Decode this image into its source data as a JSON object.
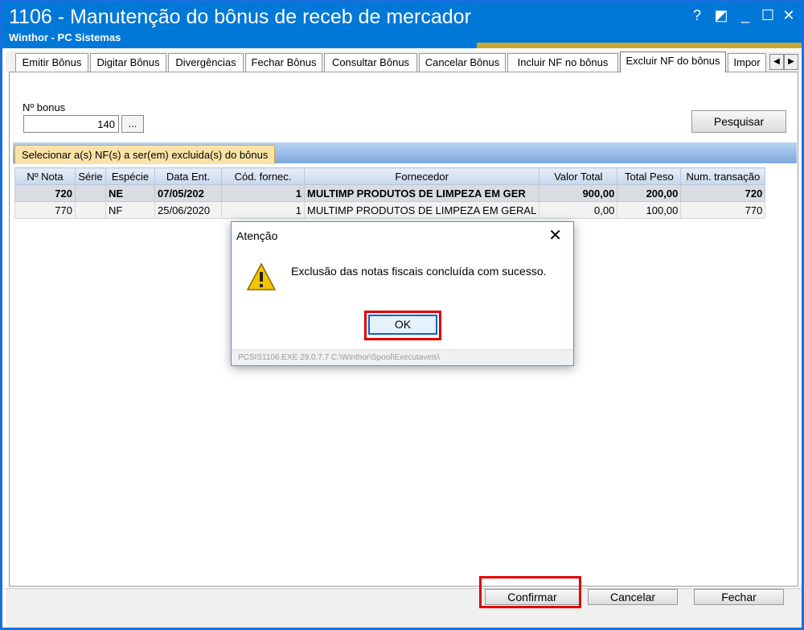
{
  "window": {
    "title": "1106 - Manutenção do bônus de receb de mercador",
    "subtitle": "Winthor - PC Sistemas",
    "help_glyph": "?",
    "restore_glyph": "◩",
    "minimize_glyph": "_",
    "maximize_glyph": "☐",
    "close_glyph": "✕"
  },
  "tabs": [
    {
      "label": "Emitir Bônus"
    },
    {
      "label": "Digitar Bônus"
    },
    {
      "label": "Divergências"
    },
    {
      "label": "Fechar Bônus"
    },
    {
      "label": "Consultar Bônus"
    },
    {
      "label": "Cancelar Bônus"
    },
    {
      "label": "Incluir NF no bônus"
    },
    {
      "label": "Excluir NF do bônus"
    },
    {
      "label": "Impor"
    }
  ],
  "tab_scroll": {
    "left": "◀",
    "right": "▶"
  },
  "form": {
    "bonus_label": "Nº bonus",
    "bonus_value": "140",
    "dots_label": "...",
    "search_button": "Pesquisar"
  },
  "subtab": {
    "label": "Selecionar a(s) NF(s) a ser(em) excluida(s) do bônus"
  },
  "grid": {
    "headers": [
      "Nº Nota",
      "Série",
      "Espécie",
      "Data Ent.",
      "Cód. fornec.",
      "Fornecedor",
      "Valor Total",
      "Total Peso",
      "Num. transação"
    ],
    "rows": [
      [
        "720",
        "",
        "NE",
        "07/05/202",
        "1",
        "MULTIMP PRODUTOS DE LIMPEZA EM GER",
        "900,00",
        "200,00",
        "720"
      ],
      [
        "770",
        "",
        "NF",
        "25/06/2020",
        "1",
        "MULTIMP PRODUTOS DE LIMPEZA EM GERAL",
        "0,00",
        "100,00",
        "770"
      ]
    ]
  },
  "bottom_buttons": {
    "confirm": "Confirmar",
    "cancel": "Cancelar",
    "close": "Fechar"
  },
  "dialog": {
    "title": "Atenção",
    "close_glyph": "✕",
    "message": "Exclusão das notas fiscais concluída com sucesso.",
    "ok_label": "OK",
    "footer": "PCSIS1106.EXE 29.0.7.7 C:\\Winthor\\Spool\\Executaveis\\"
  },
  "colors": {
    "titlebar": "#0078d7",
    "highlight": "#e00000",
    "subtab": "#fbe3a8"
  }
}
